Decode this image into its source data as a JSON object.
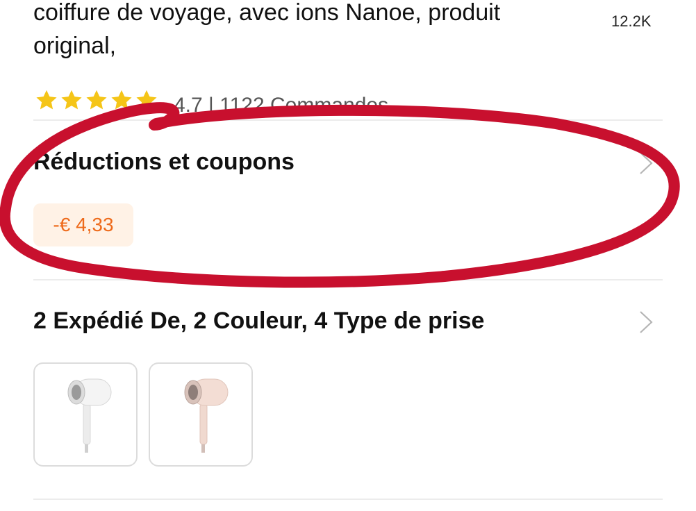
{
  "product": {
    "title": "coiffure de voyage, avec ions Nanoe, produit original,",
    "likes": "12.2K",
    "rating": {
      "stars": 5,
      "star_color": "#f5c518",
      "summary": "4.7 | 1122 Commandes"
    }
  },
  "discounts": {
    "title": "Réductions et coupons",
    "coupon_label": "-€ 4,33",
    "coupon_text_color": "#ee6a1a",
    "coupon_bg_color": "#fff2e6"
  },
  "variants": {
    "title": "2 Expédié De, 2 Couleur, 4 Type de prise",
    "items": [
      {
        "color_name": "white",
        "body_color": "#f2f2f2"
      },
      {
        "color_name": "pink",
        "body_color": "#f3ddd4"
      }
    ]
  },
  "annotation": {
    "shape": "hand-drawn-ellipse",
    "color": "#c8102e"
  },
  "icons": {
    "chevron": "chevron-right-icon",
    "star": "star-icon"
  }
}
